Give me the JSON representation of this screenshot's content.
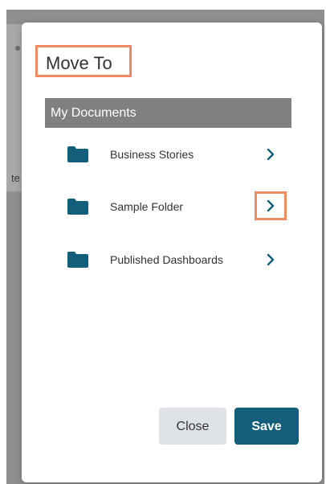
{
  "background": {
    "snippet_text": "te"
  },
  "dialog": {
    "title": "Move To",
    "root_folder": "My Documents",
    "folders": [
      {
        "label": "Business Stories",
        "icon": "folder-icon",
        "chevron": "chevron-right-icon"
      },
      {
        "label": "Sample Folder",
        "icon": "folder-icon",
        "chevron": "chevron-right-icon",
        "highlighted": true
      },
      {
        "label": "Published Dashboards",
        "icon": "folder-icon",
        "chevron": "chevron-right-icon"
      }
    ],
    "buttons": {
      "close_label": "Close",
      "save_label": "Save"
    }
  },
  "colors": {
    "accent": "#135e7a",
    "highlight": "#f08a62",
    "header_bg": "#808080",
    "folder": "#135e7a"
  }
}
